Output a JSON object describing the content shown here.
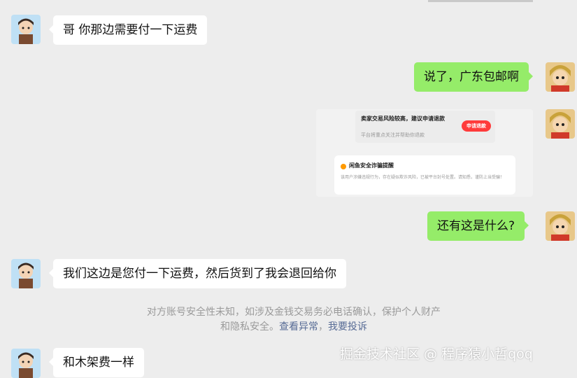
{
  "messages": {
    "m1": "哥 你那边需要付一下运费",
    "m2": "说了，广东包邮啊",
    "m4": "还有这是什么?",
    "m5": "我们这边是您付一下运费，然后货到了我会退回给你",
    "m6": "和木架费一样"
  },
  "screenshot_card": {
    "title": "卖家交易风险较高，建议申请退款",
    "subtitle": "平台将重点关注并帮助你退款",
    "button": "申请退款",
    "warning_title": "闲鱼安全诈骗提醒",
    "warning_text": "该用户涉嫌违规行为，存在疑似欺诈风险，已被平台封号处置。请知悉，谨防上当受骗！"
  },
  "system_notice": {
    "text": "对方账号安全性未知，如涉及金钱交易务必电话确认，保护个人财产和隐私安全。",
    "link_abnormal": "查看异常",
    "separator": "，",
    "link_report": "我要投诉"
  },
  "watermark": "掘金技术社区 @ 程序猿小哲qoq",
  "colors": {
    "background": "#ededed",
    "incoming_bubble": "#ffffff",
    "outgoing_bubble": "#95ec69",
    "link": "#576b95"
  }
}
